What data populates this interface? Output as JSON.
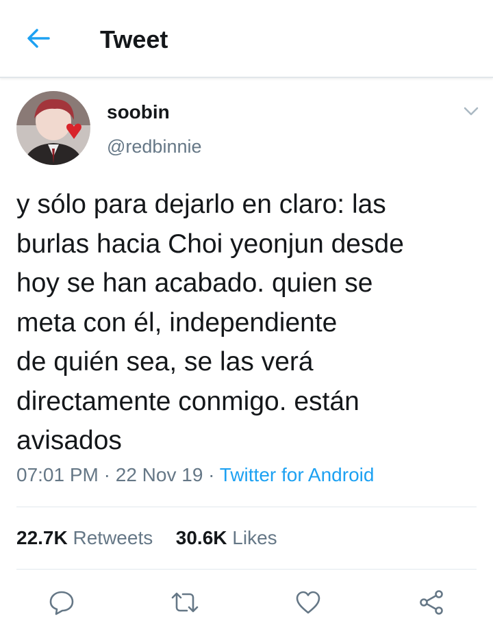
{
  "header": {
    "title": "Tweet",
    "back_icon": "arrow-left-icon"
  },
  "author": {
    "display_name": "soobin",
    "handle": "@redbinnie",
    "avatar": "profile-photo"
  },
  "tweet": {
    "lines": [
      "y sólo para dejarlo en claro: las",
      "burlas hacia Choi yeonjun desde",
      "hoy se han acabado. quien se",
      "meta con él, independiente",
      "de quién sea, se las verá",
      "directamente conmigo. están",
      "avisados"
    ],
    "time": "07:01 PM",
    "date": "22 Nov 19",
    "separator": "·",
    "source": "Twitter for Android"
  },
  "stats": {
    "retweets_count": "22.7K",
    "retweets_label": "Retweets",
    "likes_count": "30.6K",
    "likes_label": "Likes"
  },
  "actions": [
    "reply-icon",
    "retweet-icon",
    "like-icon",
    "share-icon"
  ],
  "colors": {
    "accent": "#1da1f2",
    "text_primary": "#14171a",
    "text_secondary": "#657786",
    "divider": "#e1e8ed"
  }
}
